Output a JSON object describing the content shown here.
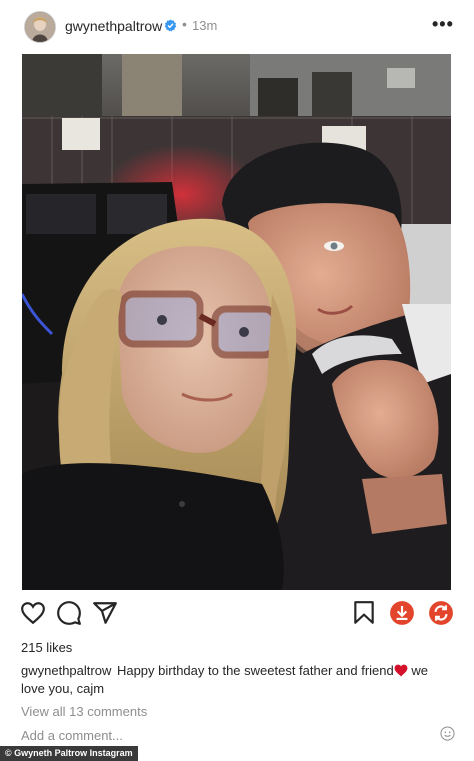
{
  "post": {
    "username": "gwynethpaltrow",
    "separator": "•",
    "time": "13m",
    "more": "•••",
    "likes": "215 likes",
    "caption_user": "gwynethpaltrow",
    "caption_text_1": "Happy birthday to the sweetest father and friend",
    "caption_text_2": " we love you, cajm",
    "view_comments": "View all 13 comments",
    "add_comment_placeholder": "Add a comment..."
  },
  "credit": "© Gwyneth Paltrow Instagram",
  "colors": {
    "verified": "#3897f0",
    "download": "#e2452b",
    "share": "#e2452b",
    "heart_emoji": "#d4102a"
  },
  "icons": [
    "verified-badge-icon",
    "more-options-icon",
    "like-heart-icon",
    "comment-icon",
    "share-send-icon",
    "bookmark-icon",
    "download-icon",
    "refresh-share-icon",
    "emoji-icon"
  ]
}
